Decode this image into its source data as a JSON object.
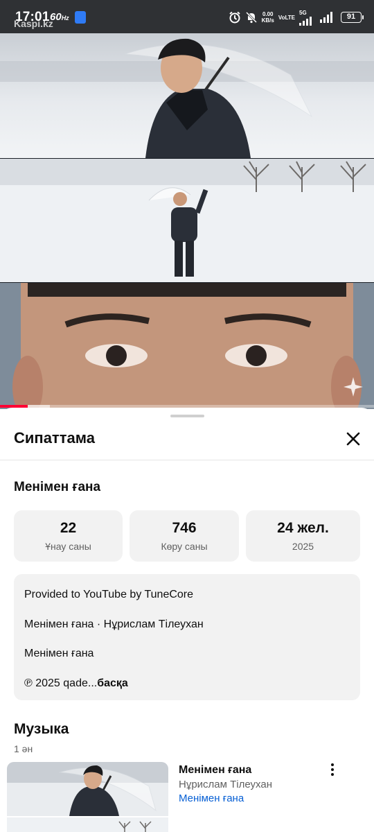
{
  "status_bar": {
    "time": "17:01",
    "refresh_rate": "60",
    "refresh_unit": "Hz",
    "watermark": "Kaspi.kz",
    "net_speed_value": "0.00",
    "net_speed_unit": "KB/s",
    "volte": "VoLTE",
    "network": "5G",
    "battery": "91"
  },
  "sheet": {
    "title": "Сипаттама",
    "song_title": "Менімен ғана",
    "stats": [
      {
        "value": "22",
        "label": "Ұнау саны"
      },
      {
        "value": "746",
        "label": "Көру саны"
      },
      {
        "value": "24 жел.",
        "label": "2025"
      }
    ],
    "description": {
      "lines": [
        "Provided to YouTube by TuneCore",
        "Менімен ғана · Нұрислам Тілеухан",
        "Менімен ғана"
      ],
      "last_line": "℗ 2025 qade...",
      "more_label": "басқа"
    },
    "music": {
      "title": "Музыка",
      "count": "1 ән",
      "track": {
        "name": "Менімен ғана",
        "artist": "Нұрислам Тілеухан",
        "album": "Менімен ғана"
      }
    }
  },
  "player": {
    "progress": 0.074,
    "accent_color": "#ff0033"
  },
  "colors": {
    "link": "#065fd4",
    "secondary_text": "#606060",
    "chip_background": "#f2f2f2"
  }
}
